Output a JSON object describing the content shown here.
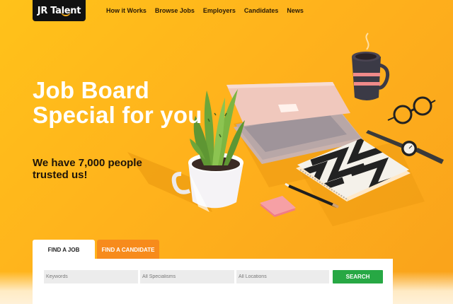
{
  "header": {
    "logo_text": "JR Talent",
    "nav": [
      {
        "label": "How it Works"
      },
      {
        "label": "Browse Jobs"
      },
      {
        "label": "Employers"
      },
      {
        "label": "Candidates"
      },
      {
        "label": "News"
      }
    ]
  },
  "hero": {
    "headline_line1": "Job Board",
    "headline_line2": "Special for you",
    "subline_line1": "We have 7,000 people",
    "subline_line2": "trusted us!"
  },
  "search": {
    "tabs": [
      {
        "label": "FIND A JOB",
        "active": true
      },
      {
        "label": "FIND A CANDIDATE",
        "active": false
      }
    ],
    "keywords_placeholder": "Keywords",
    "specialisms_value": "All Specialisms",
    "locations_value": "All Locations",
    "button_label": "SEARCH"
  },
  "colors": {
    "background": "#ffb21c",
    "logo_bg": "#111111",
    "tab_inactive": "#f78b1c",
    "search_button": "#27a844"
  },
  "icons": [
    "coffee-mug-icon",
    "laptop-icon",
    "glasses-icon",
    "watch-icon",
    "notebook-icon",
    "pen-icon",
    "sticky-note-icon",
    "plant-icon"
  ]
}
